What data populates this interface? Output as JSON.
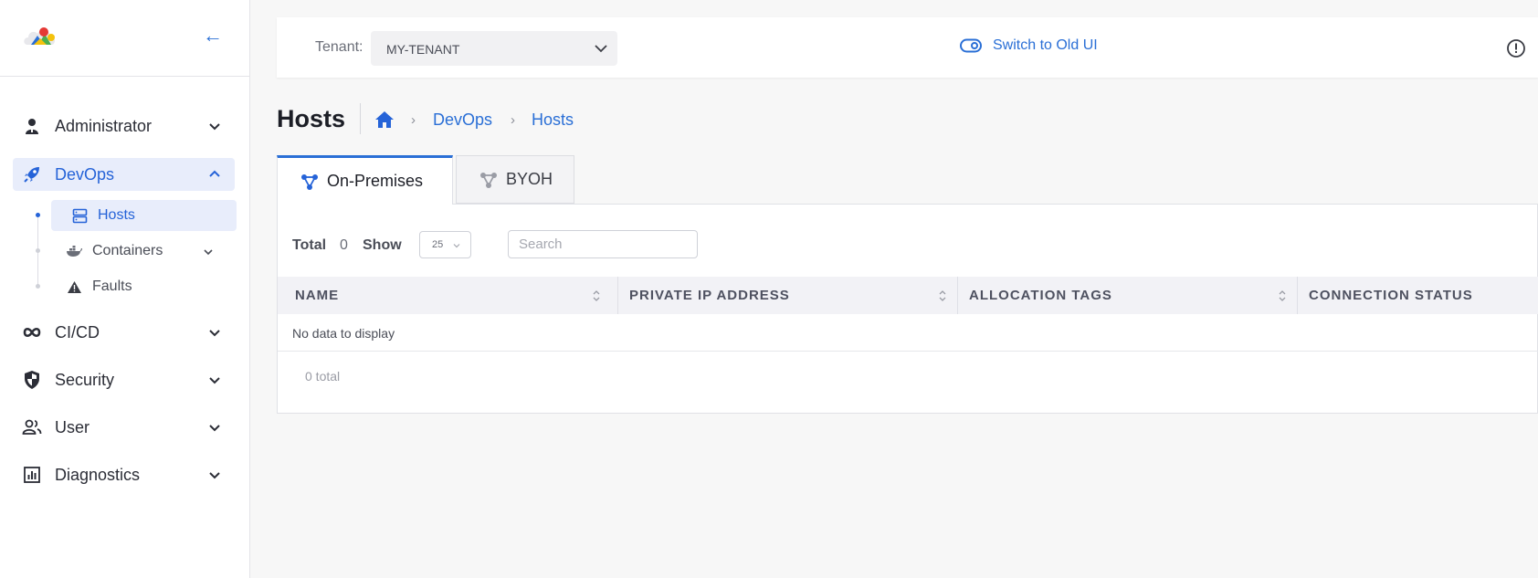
{
  "sidebar": {
    "items": [
      {
        "label": "Administrator",
        "icon": "admin-user-icon"
      },
      {
        "label": "DevOps",
        "icon": "rocket-icon"
      },
      {
        "label": "CI/CD",
        "icon": "infinity-icon"
      },
      {
        "label": "Security",
        "icon": "shield-icon"
      },
      {
        "label": "User",
        "icon": "users-icon"
      },
      {
        "label": "Diagnostics",
        "icon": "bar-chart-icon"
      }
    ],
    "devops_children": [
      {
        "label": "Hosts",
        "icon": "server-icon"
      },
      {
        "label": "Containers",
        "icon": "docker-icon"
      },
      {
        "label": "Faults",
        "icon": "warning-icon"
      }
    ]
  },
  "topbar": {
    "tenant_label": "Tenant:",
    "tenant_value": "MY-TENANT",
    "switch_label": "Switch to Old UI"
  },
  "page": {
    "title": "Hosts",
    "breadcrumb": [
      "DevOps",
      "Hosts"
    ]
  },
  "tabs": [
    {
      "label": "On-Premises"
    },
    {
      "label": "BYOH"
    }
  ],
  "table": {
    "total_label": "Total",
    "total_value": "0",
    "show_label": "Show",
    "page_size": "25",
    "search_placeholder": "Search",
    "columns": [
      "NAME",
      "PRIVATE IP ADDRESS",
      "ALLOCATION TAGS",
      "CONNECTION STATUS"
    ],
    "empty_text": "No data to display",
    "footer_total": "0 total"
  },
  "colors": {
    "accent": "#2a6fd6",
    "active_bg": "#e8edfb",
    "page_bg": "#f7f7f7",
    "header_bg": "#f2f2f6"
  }
}
